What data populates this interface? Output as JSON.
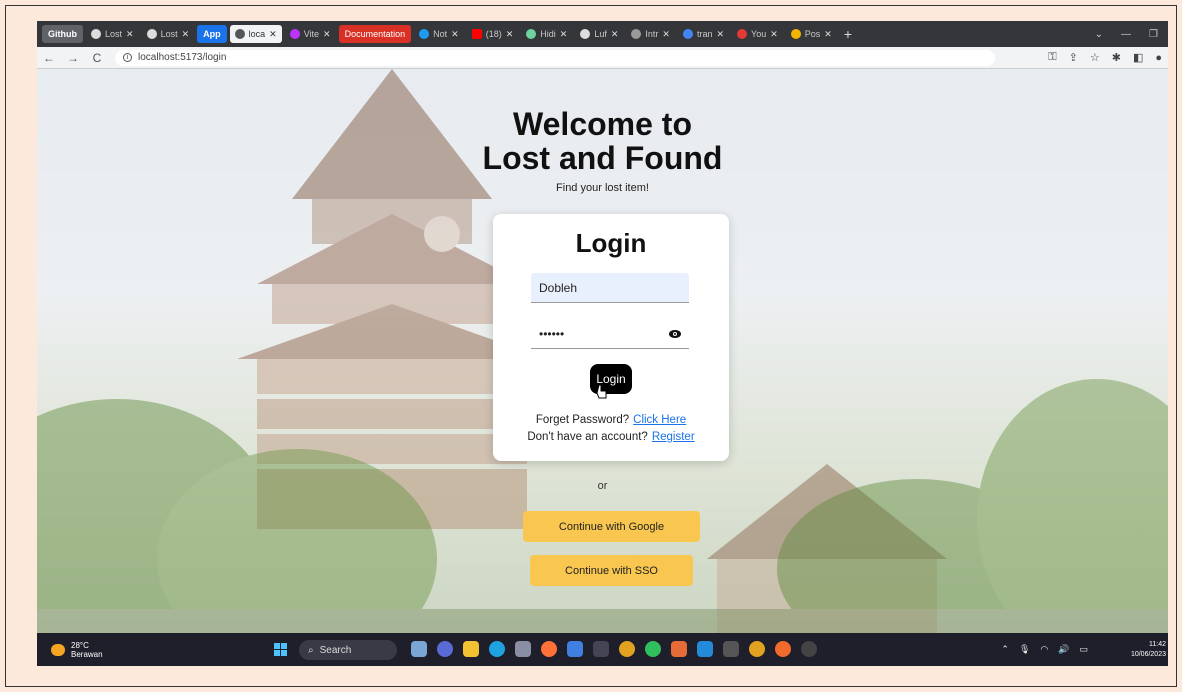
{
  "browser": {
    "tabs": [
      {
        "label": "Github",
        "type": "group",
        "color": "#5f6368"
      },
      {
        "label": "Lost",
        "icon": "github-icon"
      },
      {
        "label": "Lost",
        "icon": "github-icon"
      },
      {
        "label": "App",
        "type": "group",
        "color": "#1a73e8"
      },
      {
        "label": "loca",
        "icon": "globe-icon",
        "active": true
      },
      {
        "label": "Vite",
        "icon": "vite-icon"
      },
      {
        "label": "Documentation",
        "type": "group",
        "color": "#d93025"
      },
      {
        "label": "Not",
        "icon": "twitter-icon"
      },
      {
        "label": "(18)",
        "icon": "youtube-icon"
      },
      {
        "label": "Hidi",
        "icon": "tab-icon"
      },
      {
        "label": "Luf",
        "icon": "github-icon"
      },
      {
        "label": "Intr",
        "icon": "tab-icon"
      },
      {
        "label": "tran",
        "icon": "google-icon"
      },
      {
        "label": "You",
        "icon": "tab-icon"
      },
      {
        "label": "Pos",
        "icon": "tab-icon"
      }
    ],
    "new_tab": "+",
    "url": "localhost:5173/login"
  },
  "page": {
    "headline_line1": "Welcome to",
    "headline_line2": "Lost and Found",
    "tagline": "Find your lost item!",
    "login": {
      "title": "Login",
      "username_value": "Dobleh",
      "password_value": "••••••",
      "submit_label": "Login",
      "forgot_text": "Forget Password?",
      "forgot_link": "Click Here",
      "register_text": "Don't have an account?",
      "register_link": "Register"
    },
    "divider_text": "or",
    "google_button": "Continue with Google",
    "sso_button": "Continue with SSO"
  },
  "taskbar": {
    "weather_temp": "28°C",
    "weather_desc": "Berawan",
    "search_label": "Search",
    "time": "11:42",
    "date": "10/06/2023"
  },
  "colors": {
    "oauth_button": "#f9c74f",
    "link": "#1a73e8",
    "login_button": "#000000",
    "frame_bg": "#fde9dc"
  }
}
